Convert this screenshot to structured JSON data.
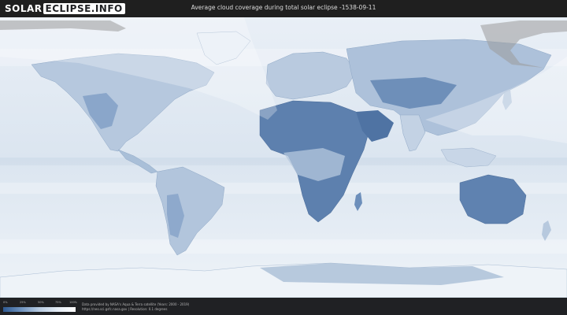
{
  "header": {
    "logo_left": "SOLAR",
    "logo_right": "ECLIPSE.INFO",
    "title": "Average cloud coverage during total solar eclipse -1538-09-11"
  },
  "legend": {
    "ticks": [
      "0%",
      "25%",
      "50%",
      "75%",
      "100%"
    ],
    "colors": [
      "#2f5a92",
      "#6f93bf",
      "#b8cbe1",
      "#e5edf6",
      "#ffffff"
    ]
  },
  "credits": {
    "line1": "Data provided by NASA's Aqua & Terra satellite (Years: 2000 - 2019)",
    "line2": "https://neo.sci.gsfc.nasa.gov  |  Resolution: 0.1 degrees"
  },
  "map": {
    "ocean_color": "#dfe8f2",
    "land_clear_color": "#5b7fae",
    "shadow_color": "#9a9a9a"
  }
}
